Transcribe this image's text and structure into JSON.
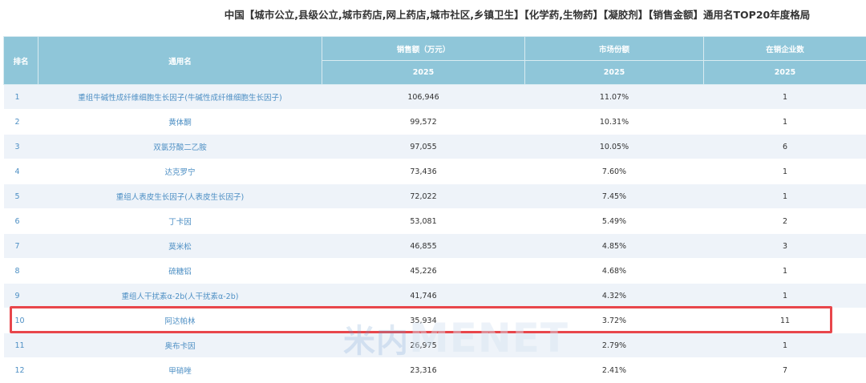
{
  "title": "中国【城市公立,县级公立,城市药店,网上药店,城市社区,乡镇卫生】【化学药,生物药】【凝胶剂】【销售金额】通用名TOP20年度格局",
  "table": {
    "headers": {
      "rank": "排名",
      "name": "通用名",
      "sales": "销售额（万元）",
      "share": "市场份额",
      "companies": "在销企业数",
      "year": "2025"
    },
    "rows": [
      {
        "rank": "1",
        "name": "重组牛碱性成纤维细胞生长因子(牛碱性成纤维细胞生长因子)",
        "sales": "106,946",
        "share": "11.07%",
        "companies": "1"
      },
      {
        "rank": "2",
        "name": "黄体酮",
        "sales": "99,572",
        "share": "10.31%",
        "companies": "1"
      },
      {
        "rank": "3",
        "name": "双氯芬酸二乙胺",
        "sales": "97,055",
        "share": "10.05%",
        "companies": "6"
      },
      {
        "rank": "4",
        "name": "达克罗宁",
        "sales": "73,436",
        "share": "7.60%",
        "companies": "1"
      },
      {
        "rank": "5",
        "name": "重组人表皮生长因子(人表皮生长因子)",
        "sales": "72,022",
        "share": "7.45%",
        "companies": "1"
      },
      {
        "rank": "6",
        "name": "丁卡因",
        "sales": "53,081",
        "share": "5.49%",
        "companies": "2"
      },
      {
        "rank": "7",
        "name": "莫米松",
        "sales": "46,855",
        "share": "4.85%",
        "companies": "3"
      },
      {
        "rank": "8",
        "name": "硫糖铝",
        "sales": "45,226",
        "share": "4.68%",
        "companies": "1"
      },
      {
        "rank": "9",
        "name": "重组人干扰素α-2b(人干扰素α-2b)",
        "sales": "41,746",
        "share": "4.32%",
        "companies": "1"
      },
      {
        "rank": "10",
        "name": "阿达帕林",
        "sales": "35,934",
        "share": "3.72%",
        "companies": "11"
      },
      {
        "rank": "11",
        "name": "奥布卡因",
        "sales": "26,975",
        "share": "2.79%",
        "companies": "1"
      },
      {
        "rank": "12",
        "name": "甲硝唑",
        "sales": "23,316",
        "share": "2.41%",
        "companies": "7"
      }
    ]
  },
  "highlight_color": "#e8464b",
  "header_color": "#8fc6d9",
  "watermark": {
    "mark": "米内",
    "text": "MENET"
  }
}
